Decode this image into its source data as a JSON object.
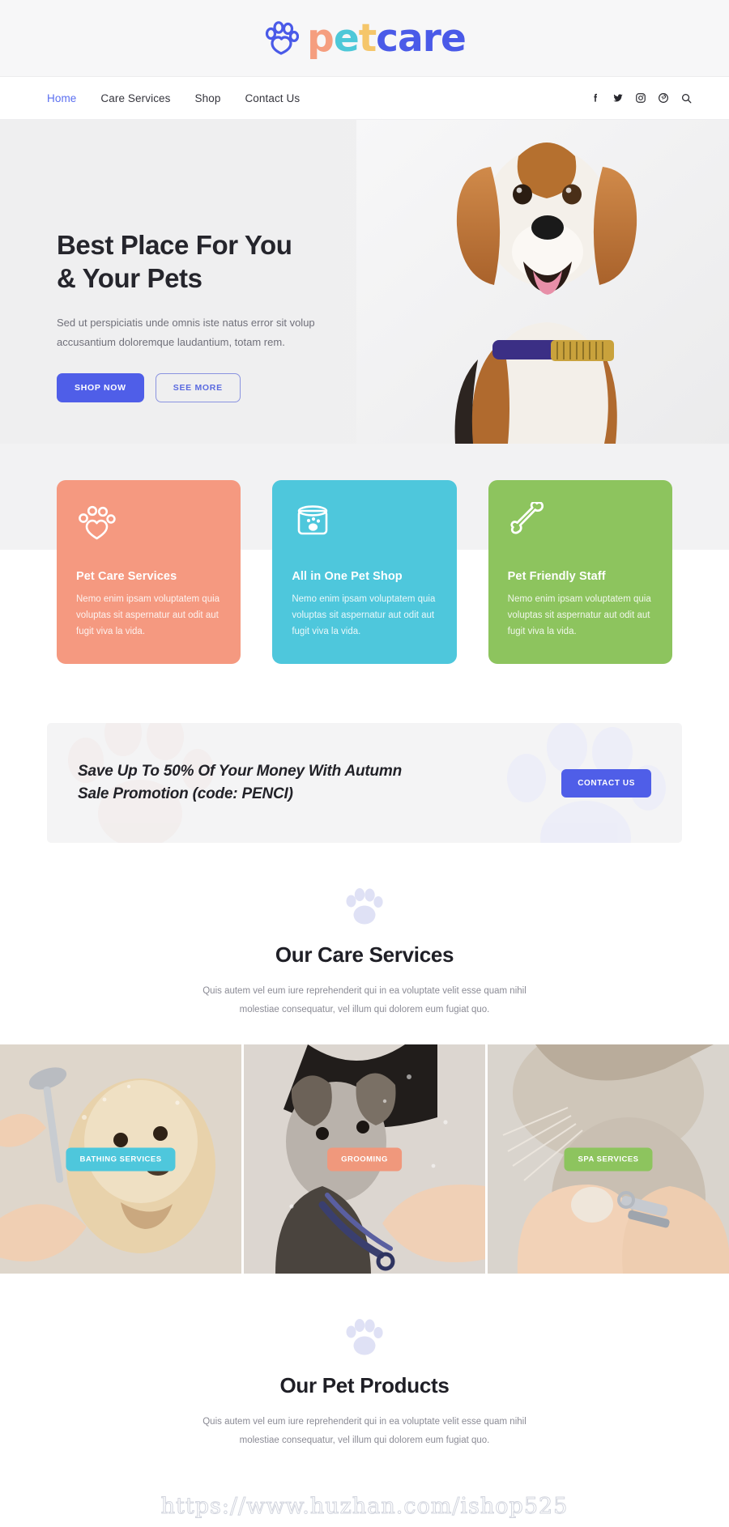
{
  "logo": {
    "paw_icon": "paw-icon",
    "letters": [
      {
        "ch": "p",
        "color": "#f59e7f"
      },
      {
        "ch": "e",
        "color": "#4dc8d8"
      },
      {
        "ch": "t",
        "color": "#f5c66a"
      },
      {
        "ch": "c",
        "color": "#4a5ae8"
      },
      {
        "ch": "a",
        "color": "#4a5ae8"
      },
      {
        "ch": "r",
        "color": "#4a5ae8"
      },
      {
        "ch": "e",
        "color": "#4a5ae8"
      }
    ],
    "full_text": "petcare"
  },
  "nav": {
    "items": [
      {
        "label": "Home",
        "active": true
      },
      {
        "label": "Care Services",
        "active": false
      },
      {
        "label": "Shop",
        "active": false
      },
      {
        "label": "Contact Us",
        "active": false
      }
    ],
    "social": [
      "facebook-icon",
      "twitter-icon",
      "instagram-icon",
      "pinterest-icon"
    ],
    "search_icon": "search-icon"
  },
  "hero": {
    "title_line1": "Best Place For You",
    "title_line2": "& Your Pets",
    "subtitle_line1": "Sed ut perspiciatis unde omnis iste natus error sit volup",
    "subtitle_line2": "accusantium doloremque laudantium, totam rem.",
    "primary_button": "SHOP NOW",
    "secondary_button": "SEE MORE",
    "image_alt": "beagle-dog-photo"
  },
  "features": [
    {
      "icon": "paw-heart-icon",
      "title": "Pet Care Services",
      "text": "Nemo enim ipsam voluptatem quia voluptas sit aspernatur aut odit aut fugit viva la vida.",
      "color": "#f59980"
    },
    {
      "icon": "pet-food-can-icon",
      "title": "All in One Pet Shop",
      "text": "Nemo enim ipsam voluptatem quia voluptas sit aspernatur aut odit aut fugit viva la vida.",
      "color": "#4ec7dc"
    },
    {
      "icon": "bone-icon",
      "title": "Pet Friendly Staff",
      "text": "Nemo enim ipsam voluptatem quia voluptas sit aspernatur aut odit aut fugit viva la vida.",
      "color": "#8dc45e"
    }
  ],
  "promo": {
    "line1": "Save Up To 50% Of Your Money With Autumn",
    "line2": "Sale Promotion (code: PENCI)",
    "button": "CONTACT US"
  },
  "care_services_section": {
    "paw_icon": "paw-icon",
    "title": "Our Care Services",
    "sub_line1": "Quis autem vel eum iure reprehenderit qui in ea voluptate velit esse quam nihil",
    "sub_line2": "molestiae consequatur, vel illum qui dolorem eum fugiat quo.",
    "cards": [
      {
        "badge": "BATHING SERVICES",
        "color": "#4ec7dc",
        "image_alt": "dog-bathing-photo"
      },
      {
        "badge": "GROOMING",
        "color": "#f0987c",
        "image_alt": "dog-grooming-photo"
      },
      {
        "badge": "SPA SERVICES",
        "color": "#8dc45e",
        "image_alt": "cat-nail-trim-photo"
      }
    ]
  },
  "products_section": {
    "paw_icon": "paw-icon",
    "title": "Our Pet Products",
    "sub_line1": "Quis autem vel eum iure reprehenderit qui in ea voluptate velit esse quam nihil",
    "sub_line2": "molestiae consequatur, vel illum qui dolorem eum fugiat quo."
  },
  "watermark": "https://www.huzhan.com/ishop525"
}
